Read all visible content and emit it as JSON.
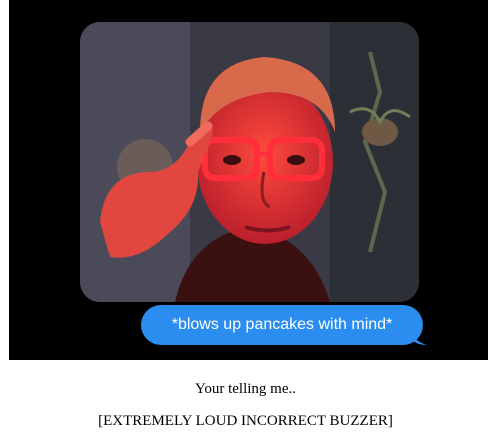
{
  "video": {
    "subject": "man with red glasses pointing at his head"
  },
  "bubble": {
    "text": "*blows up pancakes with mind*",
    "color": "#2b8df0"
  },
  "captions": {
    "line1": "Your telling me..",
    "line2": "[EXTREMELY LOUD INCORRECT BUZZER]"
  },
  "colors": {
    "panel_background": "#000000",
    "page_background": "#ffffff",
    "bubble_text": "#ffffff"
  }
}
